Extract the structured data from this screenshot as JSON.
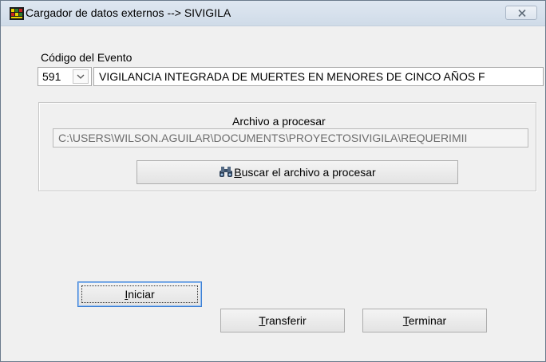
{
  "window": {
    "title": "Cargador de datos externos --> SIVIGILA",
    "close_icon": "close-icon",
    "app_icon": "application-icon"
  },
  "event": {
    "label": "Código del Evento",
    "code": "591",
    "name": "VIGILANCIA INTEGRADA DE MUERTES EN MENORES DE CINCO AÑOS F"
  },
  "file": {
    "label": "Archivo a procesar",
    "path": "C:\\USERS\\WILSON.AGUILAR\\DOCUMENTS\\PROYECTOSIVIGILA\\REQUERIMII",
    "search_icon": "binoculars-icon",
    "search_label_accel": "B",
    "search_label_rest": "uscar el archivo a procesar"
  },
  "buttons": {
    "start_accel": "I",
    "start_rest": "niciar",
    "transfer_accel": "T",
    "transfer_rest": "ransferir",
    "end_accel": "T",
    "end_rest": "erminar"
  }
}
